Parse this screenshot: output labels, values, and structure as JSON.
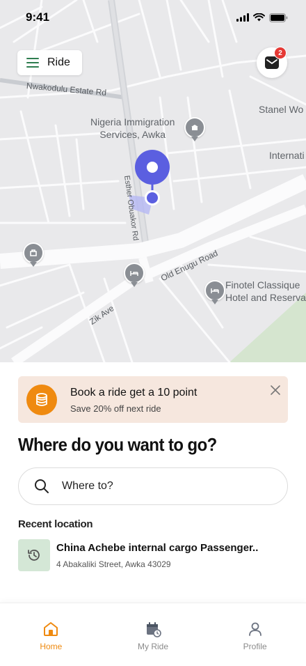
{
  "status_bar": {
    "time": "9:41"
  },
  "header": {
    "ride_label": "Ride",
    "mail_badge_count": "2"
  },
  "map": {
    "labels": {
      "nwakodulu": "Nwakodulu Estate Rd",
      "immigration": "Nigeria Immigration\nServices, Awka",
      "stanel": "Stanel Wo",
      "internat": "Internati",
      "esther": "Esther Obuakor Rd",
      "old_enugu": "Old Enugu Road",
      "zik": "Zik Ave",
      "finotel": "Finotel Classique\nHotel and Reserva"
    }
  },
  "promo": {
    "title": "Book a ride get a 10 point",
    "subtitle": "Save 20% off next ride"
  },
  "heading": "Where do you want to go?",
  "search": {
    "placeholder": "Where to?"
  },
  "recent": {
    "label": "Recent location",
    "items": [
      {
        "name": "China Achebe internal cargo Passenger..",
        "address": "4 Abakaliki Street, Awka 43029"
      }
    ]
  },
  "nav": {
    "home": "Home",
    "my_ride": "My Ride",
    "profile": "Profile"
  },
  "colors": {
    "accent": "#ef8a10",
    "pin": "#5b5fe0",
    "promo_bg": "#f6e7de",
    "recent_icon_bg": "#d4e7d6",
    "badge": "#e53935"
  }
}
